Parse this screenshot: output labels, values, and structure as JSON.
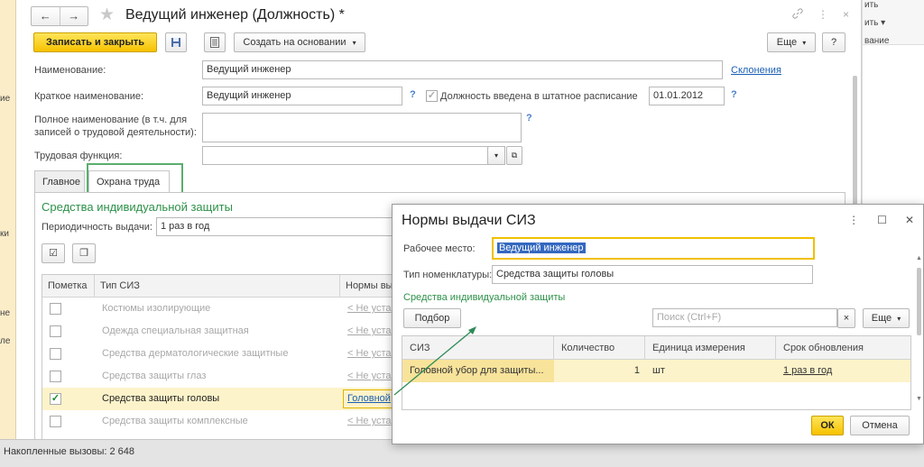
{
  "background_left": {
    "labels": [
      "ие",
      "ки",
      "не",
      "ле"
    ]
  },
  "background_right": {
    "labels": [
      "ить",
      "ить ▾",
      "вание"
    ]
  },
  "window": {
    "title": "Ведущий инженер (Должность) *",
    "back_label": "←",
    "forward_label": "→",
    "link_icon": "link-icon",
    "more_icon": "⋮",
    "close_icon": "×"
  },
  "toolbar": {
    "save_close_label": "Записать и закрыть",
    "save_icon": "💾",
    "report_icon": "▤",
    "create_based_label": "Создать на основании",
    "more_label": "Еще",
    "help_label": "?"
  },
  "form": {
    "name_label": "Наименование:",
    "name_value": "Ведущий инженер",
    "declensions_link": "Склонения",
    "short_name_label": "Краткое наименование:",
    "short_name_value": "Ведущий инженер",
    "staff_checkbox_label": "Должность введена в штатное расписание",
    "staff_date": "01.01.2012",
    "full_name_label_1": "Полное наименование (в т.ч. для",
    "full_name_label_2": "записей о трудовой деятельности):",
    "full_name_value": "",
    "labor_function_label": "Трудовая функция:",
    "labor_function_value": "",
    "help_mark": "?"
  },
  "tabs": [
    {
      "label": "Главное"
    },
    {
      "label": "Охрана труда"
    }
  ],
  "ppe_section": {
    "title": "Средства индивидуальной защиты",
    "period_label": "Периодичность выдачи:",
    "period_value": "1 раз в год"
  },
  "ppe_table": {
    "columns": [
      "Пометка",
      "Тип СИЗ",
      "Нормы вы"
    ],
    "rows": [
      {
        "checked": false,
        "type": "Костюмы изолирующие",
        "norm": "< Не уста",
        "active": false
      },
      {
        "checked": false,
        "type": "Одежда специальная защитная",
        "norm": "< Не уста",
        "active": false
      },
      {
        "checked": false,
        "type": "Средства дерматологические защитные",
        "norm": "< Не уста",
        "active": false
      },
      {
        "checked": false,
        "type": "Средства защиты глаз",
        "norm": "< Не уста",
        "active": false
      },
      {
        "checked": true,
        "type": "Средства защиты головы",
        "norm": "Головной",
        "active": true
      },
      {
        "checked": false,
        "type": "Средства защиты комплексные",
        "norm": "< Не уста",
        "active": false
      }
    ]
  },
  "status": {
    "text": "Накопленные вызовы: 2 648"
  },
  "dialog": {
    "title": "Нормы выдачи СИЗ",
    "workplace_label": "Рабочее место:",
    "workplace_value": "Ведущий инженер",
    "nomenclature_label": "Тип номенклатуры:",
    "nomenclature_value": "Средства защиты головы",
    "section_title": "Средства индивидуальной защиты",
    "pick_label": "Подбор",
    "search_placeholder": "Поиск (Ctrl+F)",
    "clear_label": "×",
    "more_label": "Еще",
    "columns": [
      "СИЗ",
      "Количество",
      "Единица измерения",
      "Срок обновления"
    ],
    "row": {
      "item": "Головной убор для защиты...",
      "quantity": "1",
      "unit": "шт",
      "renewal": "1 раз в год"
    },
    "ok_label": "ОК",
    "cancel_label": "Отмена"
  },
  "colors": {
    "accent_green": "#2d9149",
    "primary_yellow": "#f6c200",
    "link_blue": "#1a5fb4",
    "selected_row": "#fdf3ca"
  }
}
